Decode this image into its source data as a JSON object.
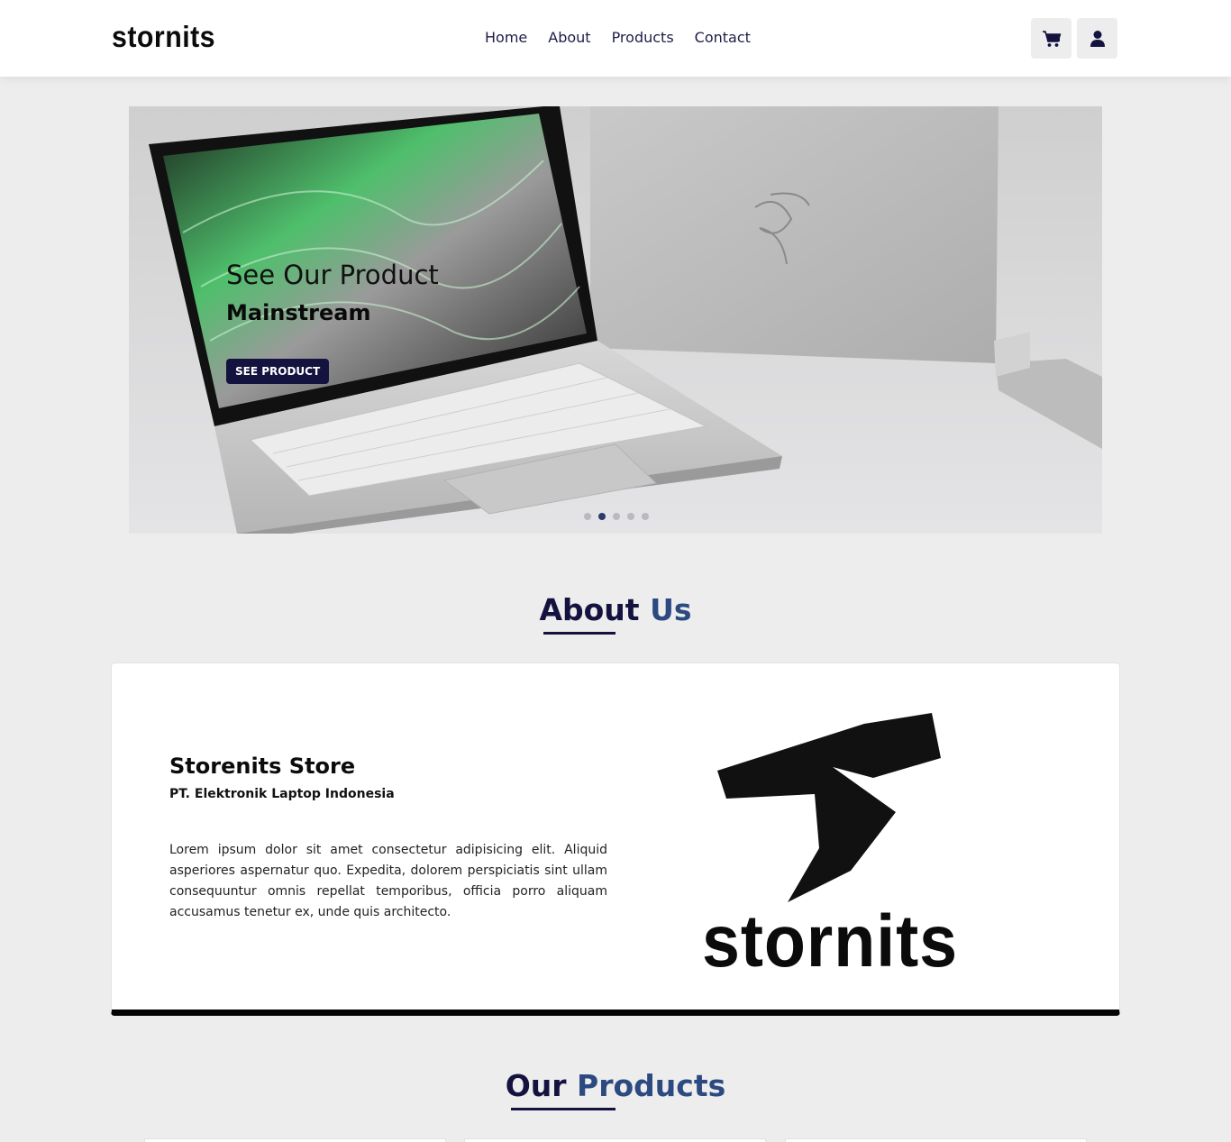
{
  "nav": {
    "brand": "stornits",
    "links": [
      "Home",
      "About",
      "Products",
      "Contact"
    ],
    "cart_icon": "cart-icon",
    "user_icon": "user-icon"
  },
  "hero": {
    "title": "See Our Product",
    "subtitle": "Mainstream",
    "button": "SEE PRODUCT",
    "slides": 5,
    "active_slide": 2
  },
  "about": {
    "heading_1": "About",
    "heading_2": "Us",
    "store_name": "Storenits Store",
    "company": "PT. Elektronik Laptop Indonesia",
    "description": "Lorem ipsum dolor sit amet consectetur adipisicing elit. Aliquid asperiores aspernatur quo. Expedita, dolorem perspiciatis sint ullam consequuntur omnis repellat temporibus, officia porro aliquam accusamus tenetur ex, unde quis architecto.",
    "logo_text": "stornits"
  },
  "products": {
    "heading_1": "Our",
    "heading_2": "Products"
  },
  "colors": {
    "navy": "#14123f",
    "accent_blue": "#2d4a80",
    "background": "#ededed"
  }
}
